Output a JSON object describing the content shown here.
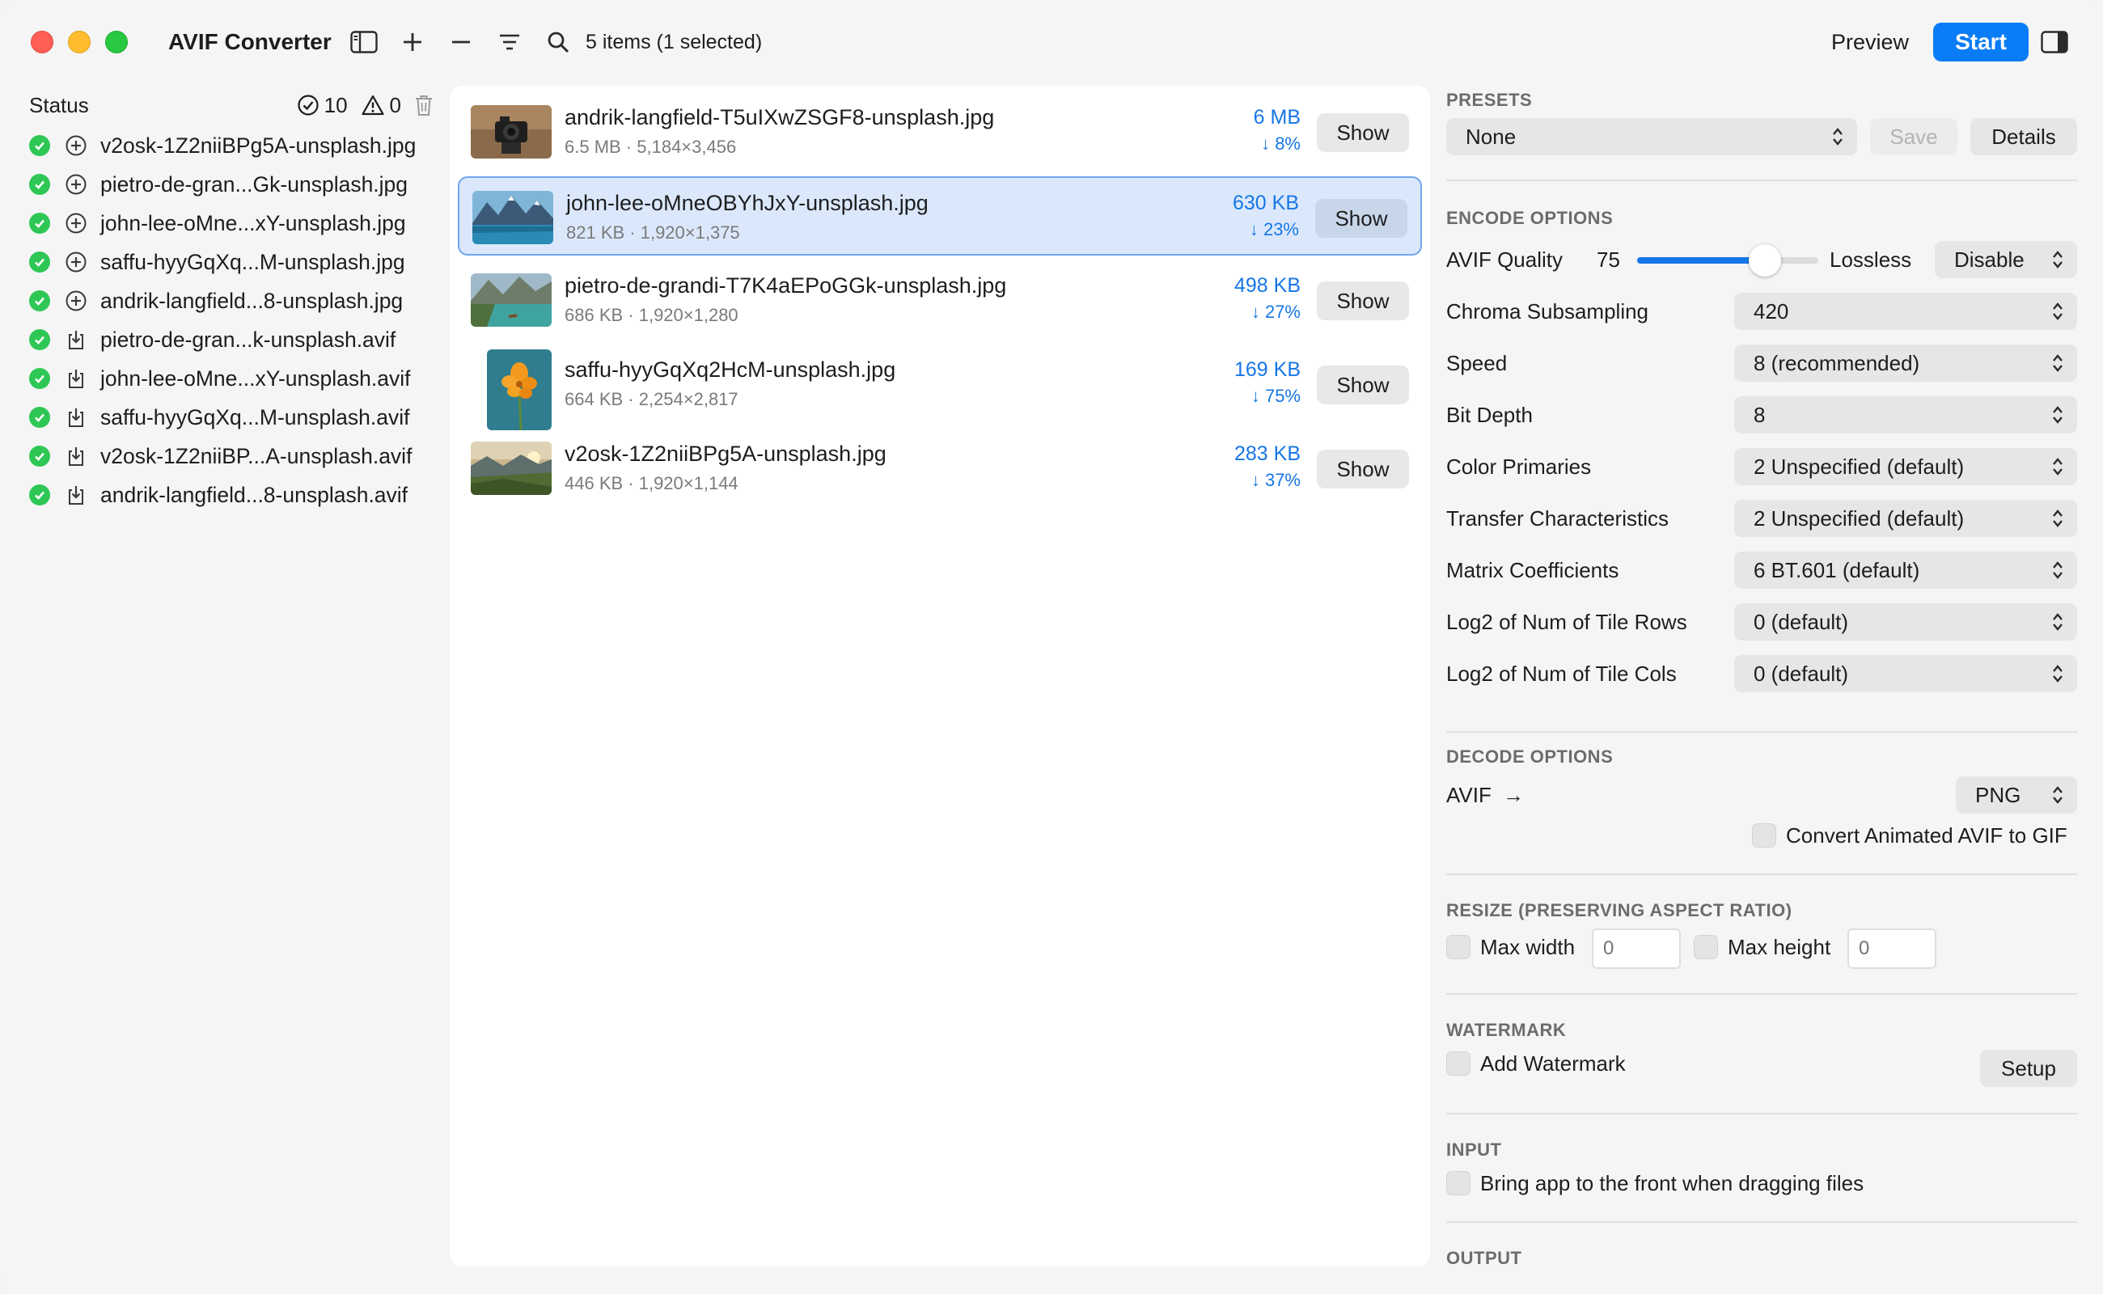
{
  "app": {
    "title": "AVIF Converter",
    "item_count": "5 items (1 selected)"
  },
  "toolbar": {
    "preview_label": "Preview",
    "start_label": "Start"
  },
  "sidebar": {
    "status_label": "Status",
    "done_count": "10",
    "warning_count": "0",
    "items": [
      {
        "label": "v2osk-1Z2niiBPg5A-unsplash.jpg",
        "kind": "input"
      },
      {
        "label": "pietro-de-gran...Gk-unsplash.jpg",
        "kind": "input"
      },
      {
        "label": "john-lee-oMne...xY-unsplash.jpg",
        "kind": "input"
      },
      {
        "label": "saffu-hyyGqXq...M-unsplash.jpg",
        "kind": "input"
      },
      {
        "label": "andrik-langfield...8-unsplash.jpg",
        "kind": "input"
      },
      {
        "label": "pietro-de-gran...k-unsplash.avif",
        "kind": "output"
      },
      {
        "label": "john-lee-oMne...xY-unsplash.avif",
        "kind": "output"
      },
      {
        "label": "saffu-hyyGqXq...M-unsplash.avif",
        "kind": "output"
      },
      {
        "label": "v2osk-1Z2niiBP...A-unsplash.avif",
        "kind": "output"
      },
      {
        "label": "andrik-langfield...8-unsplash.avif",
        "kind": "output"
      }
    ]
  },
  "files": [
    {
      "name": "andrik-langfield-T5uIXwZSGF8-unsplash.jpg",
      "meta": "6.5 MB · 5,184×3,456",
      "size": "6 MB",
      "reduction": "↓ 8%",
      "show_label": "Show",
      "thumb": "camera"
    },
    {
      "name": "john-lee-oMneOBYhJxY-unsplash.jpg",
      "meta": "821 KB · 1,920×1,375",
      "size": "630 KB",
      "reduction": "↓ 23%",
      "show_label": "Show",
      "thumb": "lake"
    },
    {
      "name": "pietro-de-grandi-T7K4aEPoGGk-unsplash.jpg",
      "meta": "686 KB · 1,920×1,280",
      "size": "498 KB",
      "reduction": "↓ 27%",
      "show_label": "Show",
      "thumb": "boat"
    },
    {
      "name": "saffu-hyyGqXq2HcM-unsplash.jpg",
      "meta": "664 KB · 2,254×2,817",
      "size": "169 KB",
      "reduction": "↓ 75%",
      "show_label": "Show",
      "thumb": "flower"
    },
    {
      "name": "v2osk-1Z2niiBPg5A-unsplash.jpg",
      "meta": "446 KB · 1,920×1,144",
      "size": "283 KB",
      "reduction": "↓ 37%",
      "show_label": "Show",
      "thumb": "valley"
    }
  ],
  "settings": {
    "presets": {
      "title": "PRESETS",
      "value": "None",
      "save_label": "Save",
      "details_label": "Details"
    },
    "encode": {
      "title": "ENCODE OPTIONS",
      "quality_label": "AVIF Quality",
      "quality_value": "75",
      "quality_fraction": 0.75,
      "lossless_label": "Lossless",
      "lossless_value": "Disable",
      "rows": [
        {
          "label": "Chroma Subsampling",
          "value": "420"
        },
        {
          "label": "Speed",
          "value": "8 (recommended)"
        },
        {
          "label": "Bit Depth",
          "value": "8"
        },
        {
          "label": "Color Primaries",
          "value": "2  Unspecified (default)"
        },
        {
          "label": "Transfer Characteristics",
          "value": "2  Unspecified (default)"
        },
        {
          "label": "Matrix Coefficients",
          "value": "6  BT.601 (default)"
        },
        {
          "label": "Log2 of Num of Tile Rows",
          "value": "0 (default)"
        },
        {
          "label": "Log2 of Num of Tile Cols",
          "value": "0 (default)"
        }
      ]
    },
    "decode": {
      "title": "DECODE OPTIONS",
      "from_label": "AVIF",
      "arrow": "→",
      "format_value": "PNG",
      "animated_label": "Convert Animated AVIF to GIF"
    },
    "resize": {
      "title": "RESIZE (PRESERVING ASPECT RATIO)",
      "max_width_label": "Max width",
      "max_width_placeholder": "0",
      "max_height_label": "Max height",
      "max_height_placeholder": "0"
    },
    "watermark": {
      "title": "WATERMARK",
      "add_label": "Add Watermark",
      "setup_label": "Setup"
    },
    "input": {
      "title": "INPUT",
      "bring_front_label": "Bring app to the front when dragging files"
    },
    "output": {
      "title": "OUTPUT"
    }
  },
  "colors": {
    "accent": "#0a7cf5",
    "link_blue": "#1677e6",
    "success": "#2ec755",
    "selection_bg": "#dbe8fb"
  }
}
